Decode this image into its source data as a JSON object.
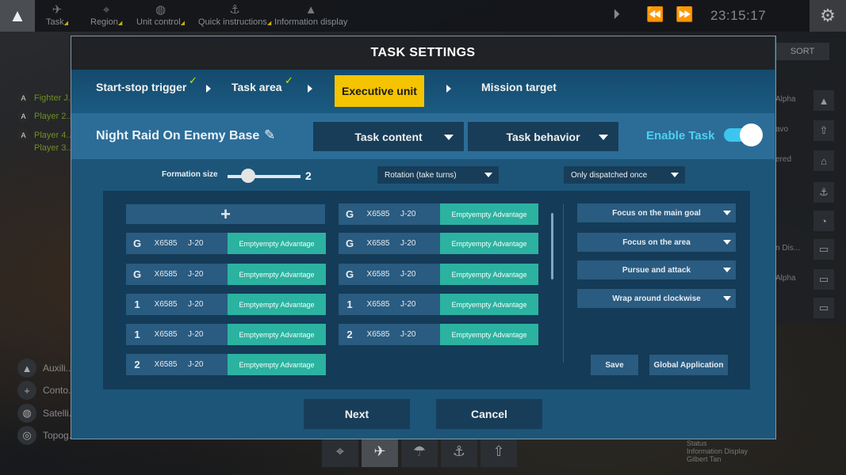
{
  "topbar": {
    "tabs": [
      {
        "label": "Task",
        "icon": "aircraft-icon"
      },
      {
        "label": "Region",
        "icon": "crosshair-icon"
      },
      {
        "label": "Unit control",
        "icon": "globe-icon"
      },
      {
        "label": "Quick instructions",
        "icon": "anchor-icon"
      },
      {
        "label": "Information display",
        "icon": "up-arrow-icon"
      }
    ],
    "clock": "23:15:17"
  },
  "left_panel": {
    "players": [
      {
        "badge": "A",
        "name": "Fighter J..."
      },
      {
        "badge": "A",
        "name": "Player 2..."
      },
      {
        "badge": "A",
        "name": "Player 4..."
      }
    ],
    "sub_item": "Player 3...",
    "tools": [
      "Auxili...",
      "Conto...",
      "Satelli...",
      "Topog..."
    ]
  },
  "right_panel": {
    "sort_label": "SORT",
    "rows": [
      "Alpha",
      "avo",
      "ered",
      "",
      "",
      "n Dis...",
      "Alpha",
      ""
    ]
  },
  "bottom_info": [
    "Status",
    "Information Display",
    "Gilbert Tan"
  ],
  "dialog": {
    "title": "TASK SETTINGS",
    "steps": [
      {
        "label": "Start-stop trigger",
        "done": true
      },
      {
        "label": "Task area",
        "done": true
      },
      {
        "label": "Executive unit",
        "active": true
      },
      {
        "label": "Mission target"
      }
    ],
    "check_mark": "✓",
    "task_name": "Night Raid On Enemy Base",
    "task_content_label": "Task content",
    "task_behavior_label": "Task behavior",
    "enable_label": "Enable Task",
    "enabled": true,
    "formation_label": "Formation size",
    "formation_value": "2",
    "rotation_option": "Rotation (take turns)",
    "dispatch_option": "Only dispatched once",
    "add_symbol": "+",
    "units_left": [
      {
        "grade": "G",
        "code": "X6585",
        "type": "J-20",
        "advantage": "Emptyempty Advantage"
      },
      {
        "grade": "G",
        "code": "X6585",
        "type": "J-20",
        "advantage": "Emptyempty Advantage"
      },
      {
        "grade": "1",
        "code": "X6585",
        "type": "J-20",
        "advantage": "Emptyempty Advantage"
      },
      {
        "grade": "1",
        "code": "X6585",
        "type": "J-20",
        "advantage": "Emptyempty Advantage"
      },
      {
        "grade": "2",
        "code": "X6585",
        "type": "J-20",
        "advantage": "Emptyempty Advantage"
      }
    ],
    "units_right": [
      {
        "grade": "G",
        "code": "X6585",
        "type": "J-20",
        "advantage": "Emptyempty Advantage"
      },
      {
        "grade": "G",
        "code": "X6585",
        "type": "J-20",
        "advantage": "Emptyempty Advantage"
      },
      {
        "grade": "G",
        "code": "X6585",
        "type": "J-20",
        "advantage": "Emptyempty Advantage"
      },
      {
        "grade": "1",
        "code": "X6585",
        "type": "J-20",
        "advantage": "Emptyempty Advantage"
      },
      {
        "grade": "2",
        "code": "X6585",
        "type": "J-20",
        "advantage": "Emptyempty Advantage"
      }
    ],
    "goals": [
      "Focus on the main goal",
      "Focus on the area",
      "Pursue and attack",
      "Wrap around clockwise"
    ],
    "save_label": "Save",
    "global_label": "Global Application",
    "next_label": "Next",
    "cancel_label": "Cancel"
  },
  "colors": {
    "accent_yellow": "#f5c400",
    "enable_blue": "#4fd0f0",
    "advantage_teal": "#2cb2a0",
    "check_green": "#c8e600",
    "dialog_blue": "#1d5579"
  }
}
